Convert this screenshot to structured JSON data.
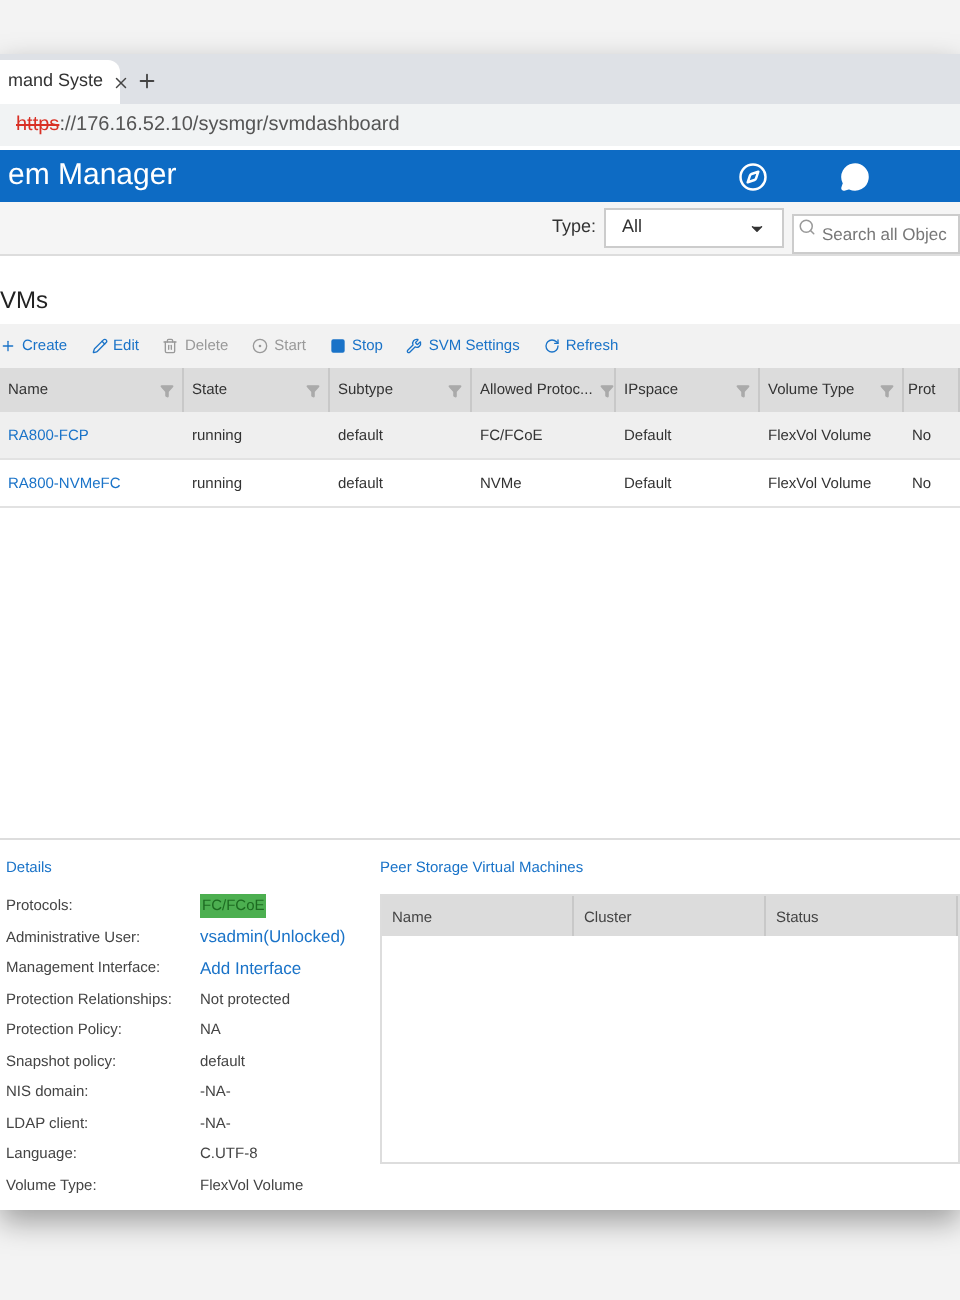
{
  "browser": {
    "tab_title": "mand Syste",
    "address_scheme": "https",
    "address_rest": "://176.16.52.10/sysmgr/svmdashboard"
  },
  "app": {
    "title": "em Manager"
  },
  "filter": {
    "type_label": "Type:",
    "type_value": "All",
    "search_placeholder": "Search all Objec"
  },
  "section_title": "VMs",
  "toolbar": [
    {
      "label": "Create",
      "disabled": false
    },
    {
      "label": "Edit",
      "disabled": false
    },
    {
      "label": "Delete",
      "disabled": true
    },
    {
      "label": "Start",
      "disabled": true
    },
    {
      "label": "Stop",
      "disabled": false
    },
    {
      "label": "SVM Settings",
      "disabled": false
    },
    {
      "label": "Refresh",
      "disabled": false
    }
  ],
  "table": {
    "columns": [
      "Name",
      "State",
      "Subtype",
      "Allowed Protoc...",
      "IPspace",
      "Volume Type",
      "Prot"
    ],
    "rows": [
      {
        "selected": true,
        "cells": [
          "RA800-FCP",
          "running",
          "default",
          "FC/FCoE",
          "Default",
          "FlexVol Volume",
          "No"
        ]
      },
      {
        "selected": false,
        "cells": [
          "RA800-NVMeFC",
          "running",
          "default",
          "NVMe",
          "Default",
          "FlexVol Volume",
          "No"
        ]
      }
    ]
  },
  "details": {
    "title": "Details",
    "items": [
      {
        "label": "Protocols:",
        "value": "FC/FCoE",
        "kind": "highlight"
      },
      {
        "label": "Administrative User:",
        "value": "vsadmin(Unlocked)",
        "kind": "link"
      },
      {
        "label": "Management Interface:",
        "value": "Add Interface",
        "kind": "link"
      },
      {
        "label": "Protection Relationships:",
        "value": "Not protected",
        "kind": "text"
      },
      {
        "label": "Protection Policy:",
        "value": "NA",
        "kind": "text"
      },
      {
        "label": "Snapshot policy:",
        "value": "default",
        "kind": "text"
      },
      {
        "label": "NIS domain:",
        "value": "-NA-",
        "kind": "text"
      },
      {
        "label": "LDAP client:",
        "value": "-NA-",
        "kind": "text"
      },
      {
        "label": "Language:",
        "value": "C.UTF-8",
        "kind": "text"
      },
      {
        "label": "Volume Type:",
        "value": "FlexVol Volume",
        "kind": "text"
      }
    ]
  },
  "peers": {
    "title": "Peer Storage Virtual Machines",
    "columns": [
      "Name",
      "Cluster",
      "Status"
    ]
  }
}
